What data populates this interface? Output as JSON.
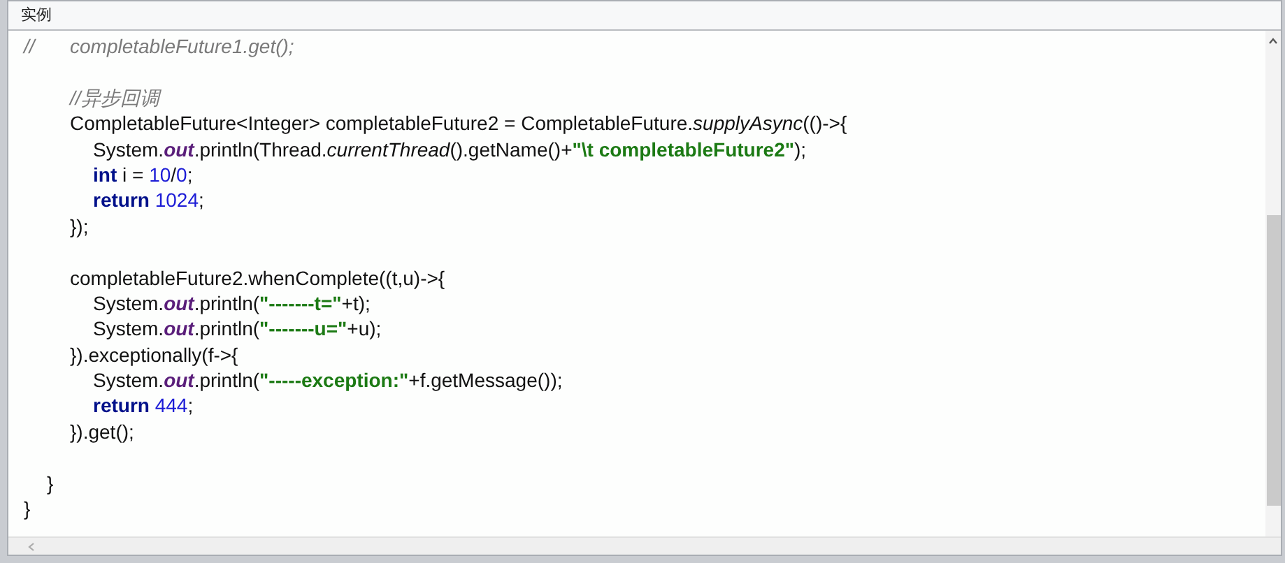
{
  "panel": {
    "title": "实例"
  },
  "code_lines": [
    {
      "kind": "code",
      "tokens": [
        {
          "kind": "comment",
          "text": "//\t\tcompletableFuture1.get();"
        }
      ]
    },
    {
      "kind": "blank"
    },
    {
      "kind": "code",
      "tokens": [
        {
          "kind": "comment",
          "text": "\t\t//异步回调"
        }
      ]
    },
    {
      "kind": "code",
      "tokens": [
        {
          "kind": "plain",
          "text": "\t\tCompletableFuture<Integer> completableFuture2 = CompletableFuture."
        },
        {
          "kind": "static_method",
          "text": "supplyAsync"
        },
        {
          "kind": "plain",
          "text": "(()->{"
        }
      ]
    },
    {
      "kind": "code",
      "tokens": [
        {
          "kind": "plain",
          "text": "\t\t\tSystem."
        },
        {
          "kind": "static_field",
          "text": "out"
        },
        {
          "kind": "plain",
          "text": ".println(Thread."
        },
        {
          "kind": "static_method",
          "text": "currentThread"
        },
        {
          "kind": "plain",
          "text": "().getName()+"
        },
        {
          "kind": "string",
          "text": "\"\\t completableFuture2\""
        },
        {
          "kind": "plain",
          "text": ");"
        }
      ]
    },
    {
      "kind": "code",
      "tokens": [
        {
          "kind": "keyword",
          "text": "\t\t\tint"
        },
        {
          "kind": "plain",
          "text": " i = "
        },
        {
          "kind": "number",
          "text": "10"
        },
        {
          "kind": "plain",
          "text": "/"
        },
        {
          "kind": "number",
          "text": "0"
        },
        {
          "kind": "plain",
          "text": ";"
        }
      ]
    },
    {
      "kind": "code",
      "tokens": [
        {
          "kind": "keyword",
          "text": "\t\t\treturn"
        },
        {
          "kind": "number",
          "text": " 1024"
        },
        {
          "kind": "plain",
          "text": ";"
        }
      ]
    },
    {
      "kind": "code",
      "tokens": [
        {
          "kind": "plain",
          "text": "\t\t});"
        }
      ]
    },
    {
      "kind": "blank"
    },
    {
      "kind": "code",
      "tokens": [
        {
          "kind": "plain",
          "text": "\t\tcompletableFuture2.whenComplete((t,u)->{"
        }
      ]
    },
    {
      "kind": "code",
      "tokens": [
        {
          "kind": "plain",
          "text": "\t\t\tSystem."
        },
        {
          "kind": "static_field",
          "text": "out"
        },
        {
          "kind": "plain",
          "text": ".println("
        },
        {
          "kind": "string",
          "text": "\"-------t=\""
        },
        {
          "kind": "plain",
          "text": "+t);"
        }
      ]
    },
    {
      "kind": "code",
      "tokens": [
        {
          "kind": "plain",
          "text": "\t\t\tSystem."
        },
        {
          "kind": "static_field",
          "text": "out"
        },
        {
          "kind": "plain",
          "text": ".println("
        },
        {
          "kind": "string",
          "text": "\"-------u=\""
        },
        {
          "kind": "plain",
          "text": "+u);"
        }
      ]
    },
    {
      "kind": "code",
      "tokens": [
        {
          "kind": "plain",
          "text": "\t\t}).exceptionally(f->{"
        }
      ]
    },
    {
      "kind": "code",
      "tokens": [
        {
          "kind": "plain",
          "text": "\t\t\tSystem."
        },
        {
          "kind": "static_field",
          "text": "out"
        },
        {
          "kind": "plain",
          "text": ".println("
        },
        {
          "kind": "string",
          "text": "\"-----exception:\""
        },
        {
          "kind": "plain",
          "text": "+f.getMessage());"
        }
      ]
    },
    {
      "kind": "code",
      "tokens": [
        {
          "kind": "keyword",
          "text": "\t\t\treturn"
        },
        {
          "kind": "number",
          "text": " 444"
        },
        {
          "kind": "plain",
          "text": ";"
        }
      ]
    },
    {
      "kind": "code",
      "tokens": [
        {
          "kind": "plain",
          "text": "\t\t}).get();"
        }
      ]
    },
    {
      "kind": "blank"
    },
    {
      "kind": "code",
      "tokens": [
        {
          "kind": "plain",
          "text": "\t}"
        }
      ]
    },
    {
      "kind": "code",
      "tokens": [
        {
          "kind": "plain",
          "text": "}"
        }
      ]
    }
  ]
}
